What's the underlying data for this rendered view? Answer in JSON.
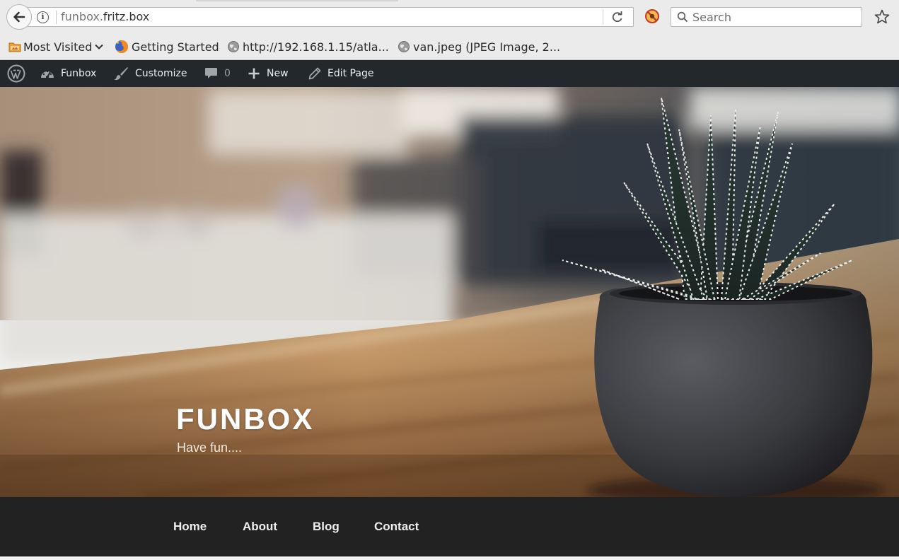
{
  "browser": {
    "url_prefix": "funbox.",
    "url_domain": "fritz.box",
    "search_placeholder": "Search",
    "bookmarks": [
      {
        "label": "Most Visited"
      },
      {
        "label": "Getting Started"
      },
      {
        "label": "http://192.168.1.15/atla..."
      },
      {
        "label": "van.jpeg (JPEG Image, 2..."
      }
    ]
  },
  "adminbar": {
    "site_label": "Funbox",
    "customize_label": "Customize",
    "comments_count": "0",
    "new_label": "New",
    "edit_label": "Edit Page"
  },
  "site": {
    "title": "FUNBOX",
    "tagline": "Have fun...."
  },
  "nav": {
    "items": [
      {
        "label": "Home"
      },
      {
        "label": "About"
      },
      {
        "label": "Blog"
      },
      {
        "label": "Contact"
      }
    ]
  },
  "colors": {
    "adminbar_bg": "#23282d",
    "nav_bg": "#222222",
    "title_color": "#ffffff"
  }
}
